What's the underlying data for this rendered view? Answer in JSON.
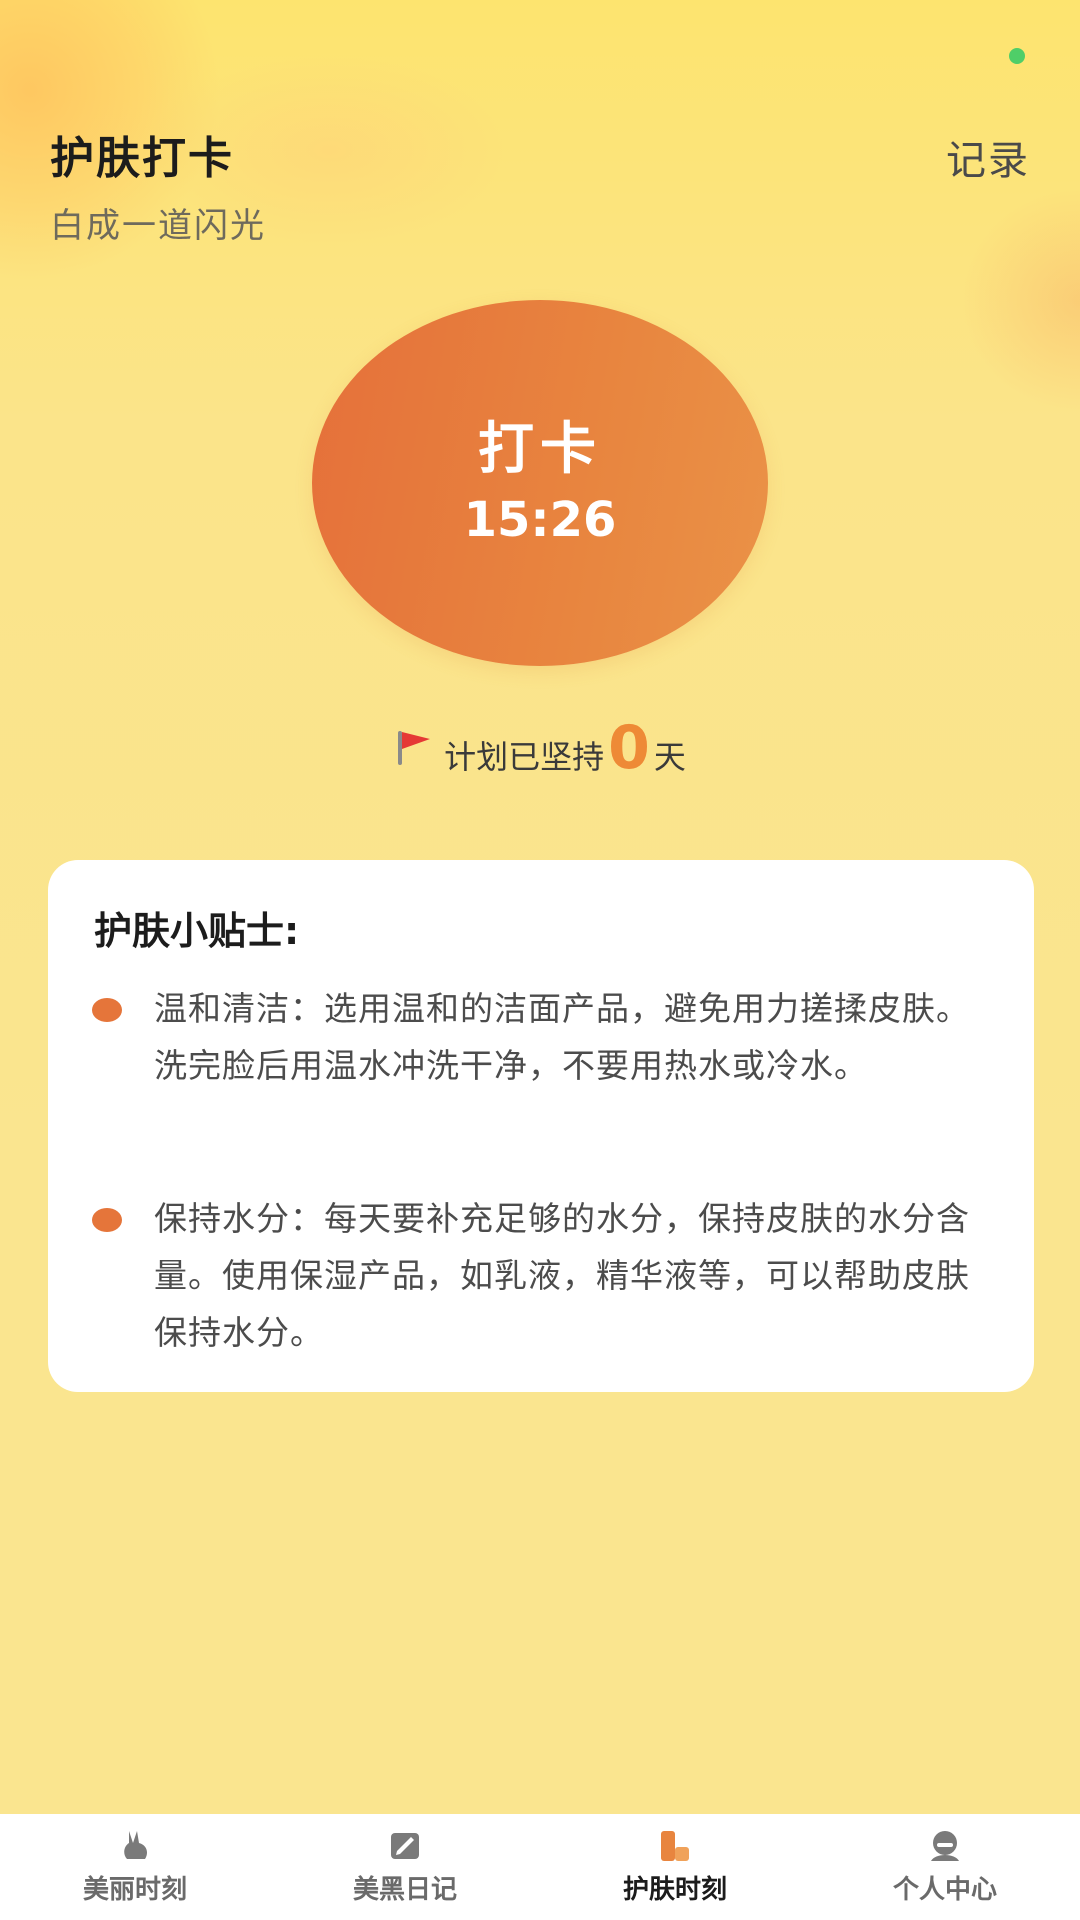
{
  "header": {
    "title": "护肤打卡",
    "subtitle": "白成一道闪光",
    "record_label": "记录"
  },
  "checkin": {
    "label": "打卡",
    "time": "15:26"
  },
  "streak": {
    "prefix": "计划已坚持",
    "count": "0",
    "suffix": "天",
    "icon": "red-flag-icon"
  },
  "tips": {
    "title": "护肤小贴士:",
    "items": [
      {
        "text": "温和清洁：选用温和的洁面产品，避免用力搓揉皮肤。洗完脸后用温水冲洗干净，不要用热水或冷水。"
      },
      {
        "text": "保持水分：每天要补充足够的水分，保持皮肤的水分含量。使用保湿产品，如乳液，精华液等，可以帮助皮肤保持水分。"
      }
    ]
  },
  "tabbar": {
    "items": [
      {
        "label": "美丽时刻",
        "icon": "rabbit-icon",
        "active": false
      },
      {
        "label": "美黑日记",
        "icon": "notebook-icon",
        "active": false
      },
      {
        "label": "护肤时刻",
        "icon": "bottle-icon",
        "active": true
      },
      {
        "label": "个人中心",
        "icon": "person-icon",
        "active": false
      }
    ]
  },
  "colors": {
    "background": "#fae48c",
    "accent": "#e5753a",
    "streak_count": "#ee8a36",
    "status_dot": "#4fce68"
  }
}
